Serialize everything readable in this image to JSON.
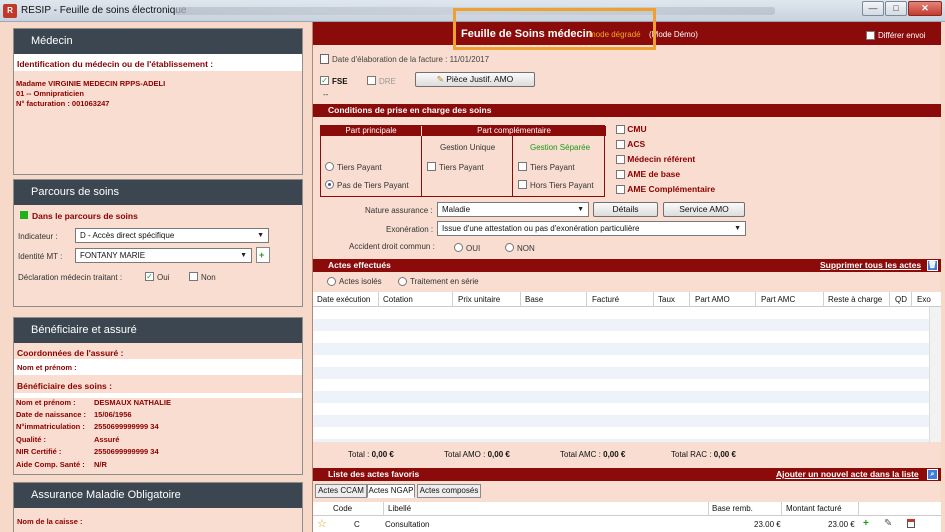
{
  "window": {
    "title": "RESIP - Feuille de soins électronique",
    "minimize": "—",
    "maximize": "□",
    "close": "✕"
  },
  "medecin": {
    "header": "Médecin",
    "ident_title": "Identification du médecin ou de l'établissement :",
    "name": "Madame VIRGINIE MEDECIN RPPS-ADELI",
    "speciality": "01 -- Omnipraticien",
    "facturation": "N° facturation : 001063247"
  },
  "parcours": {
    "header": "Parcours de soins",
    "status": "Dans le parcours de soins",
    "indicateur_label": "Indicateur :",
    "indicateur_value": "D - Accès direct spécifique",
    "identite_label": "Identité MT :",
    "identite_value": "FONTANY MARIE",
    "declaration_label": "Déclaration médecin traitant :",
    "oui": "Oui",
    "non": "Non"
  },
  "beneficiaire": {
    "header": "Bénéficiaire et assuré",
    "coord_title": "Coordonnées de l'assuré :",
    "nom_prenom_label": "Nom et prénom :",
    "benef_title": "Bénéficiaire des soins :",
    "fields": [
      {
        "label": "Nom et prénom :",
        "value": "DESMAUX NATHALIE"
      },
      {
        "label": "Date de naissance :",
        "value": "15/06/1956"
      },
      {
        "label": "N°immatriculation :",
        "value": "2550699999999 34"
      },
      {
        "label": "Qualité :",
        "value": "Assuré"
      },
      {
        "label": "NIR Certifié :",
        "value": "2550699999999 34"
      },
      {
        "label": "Aide Comp. Santé :",
        "value": "N/R"
      }
    ]
  },
  "amo": {
    "header": "Assurance Maladie Obligatoire",
    "caisse_label": "Nom de la caisse :"
  },
  "feuille": {
    "title": "Feuille de Soins médecin",
    "mode": "mode dégradé",
    "demo": "(Mode Démo)",
    "differer": "Différer envoi",
    "date_label": "Date d'élaboration de la facture : 11/01/2017",
    "fse": "FSE",
    "dre": "DRE",
    "piece_btn": "Pièce Justif. AMO",
    "dashes": "--"
  },
  "conditions": {
    "header": "Conditions de prise en charge des soins",
    "part_principale": "Part principale",
    "part_complementaire": "Part complémentaire",
    "gestion_unique": "Gestion Unique",
    "gestion_separee": "Gestion Séparée",
    "tiers_payant": "Tiers Payant",
    "pas_tiers_payant": "Pas de Tiers Payant",
    "tiers_payant2": "Tiers Payant",
    "tiers_payant3": "Tiers Payant",
    "hors_tiers": "Hors Tiers Payant",
    "side_checks": [
      "CMU",
      "ACS",
      "Médecin référent",
      "AME de base",
      "AME Complémentaire"
    ],
    "nature_label": "Nature assurance :",
    "nature_value": "Maladie",
    "details_btn": "Détails",
    "service_btn": "Service AMO",
    "exoneration_label": "Exonération :",
    "exoneration_value": "Issue d'une attestation ou pas d'exonération particulière",
    "accident_label": "Accident droit commun :",
    "accident_oui": "OUI",
    "accident_non": "NON"
  },
  "actes": {
    "header": "Actes effectués",
    "supprimer": "Supprimer tous les actes",
    "isoles": "Actes isolés",
    "serie": "Traitement en série",
    "columns": [
      "Date exécution",
      "Cotation",
      "Prix unitaire",
      "Base",
      "Facturé",
      "Taux",
      "Part AMO",
      "Part AMC",
      "Reste à charge",
      "QD",
      "Exo"
    ],
    "totals": [
      {
        "label": "Total : ",
        "value": "0,00 €"
      },
      {
        "label": "Total AMO : ",
        "value": "0,00 €"
      },
      {
        "label": "Total AMC : ",
        "value": "0,00 €"
      },
      {
        "label": "Total RAC : ",
        "value": "0,00 €"
      }
    ]
  },
  "favoris": {
    "header": "Liste des actes favoris",
    "ajouter": "Ajouter un nouvel acte dans la liste",
    "tabs": [
      "Actes CCAM",
      "Actes NGAP",
      "Actes composés"
    ],
    "columns": [
      "Code",
      "Libellé",
      "Base remb.",
      "Montant facturé"
    ],
    "row": {
      "code": "C",
      "libelle": "Consultation",
      "base": "23.00 €",
      "montant": "23.00 €"
    }
  }
}
